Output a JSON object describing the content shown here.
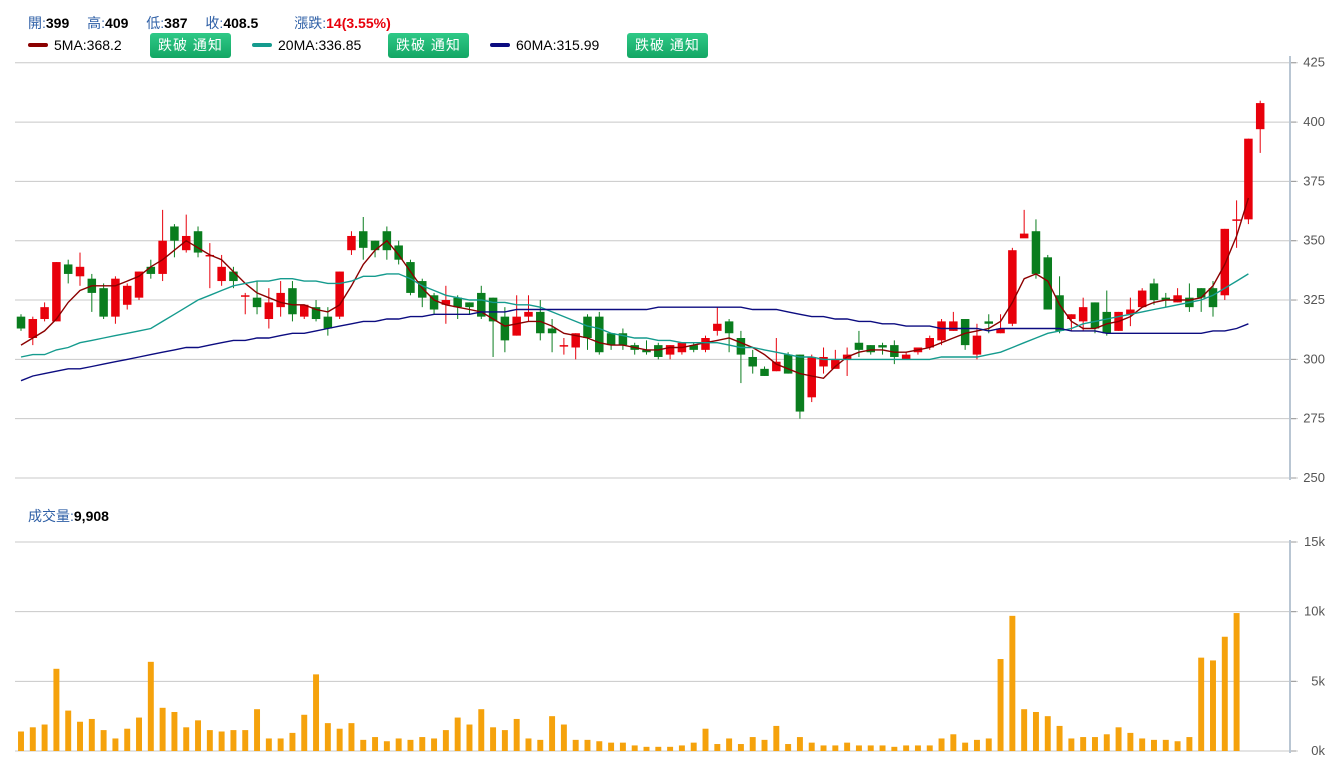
{
  "header": {
    "open_label": "開:",
    "open_value": "399",
    "high_label": "高:",
    "high_value": "409",
    "low_label": "低:",
    "low_value": "387",
    "close_label": "收:",
    "close_value": "408.5",
    "change_label": "漲跌:",
    "change_value": "14(3.55%)"
  },
  "legend": {
    "ma5": {
      "label": "5MA:368.2",
      "color": "#8b0000"
    },
    "ma20": {
      "label": "20MA:336.85",
      "color": "#159b8e"
    },
    "ma60": {
      "label": "60MA:315.99",
      "color": "#0c0c80"
    },
    "alert_button": "跌破 通知"
  },
  "volume_label": {
    "label": "成交量:",
    "value": "9,908"
  },
  "colors": {
    "up": "#e8000b",
    "down": "#0a7d1e",
    "volume": "#f5a20c",
    "grid": "#c8c8c8"
  },
  "chart_data": [
    {
      "type": "candlestick",
      "title": "",
      "y_ticks": [
        250,
        275,
        300,
        325,
        350,
        375,
        400,
        425
      ],
      "ylim": [
        250,
        427
      ],
      "series": [
        {
          "name": "OHLC",
          "points": [
            [
              318,
              313,
              319,
              312
            ],
            [
              309,
              317,
              318,
              306
            ],
            [
              317,
              322,
              324,
              316
            ],
            [
              316,
              341,
              341,
              316
            ],
            [
              340,
              336,
              342,
              332
            ],
            [
              335,
              339,
              345,
              331
            ],
            [
              334,
              328,
              336,
              320
            ],
            [
              330,
              318,
              332,
              317
            ],
            [
              318,
              334,
              335,
              315
            ],
            [
              323,
              331,
              332,
              321
            ],
            [
              326,
              337,
              337,
              325
            ],
            [
              339,
              336,
              342,
              334
            ],
            [
              336,
              350,
              363,
              333
            ],
            [
              356,
              350,
              357,
              343
            ],
            [
              346,
              352,
              361,
              345
            ],
            [
              354,
              345,
              356,
              343
            ],
            [
              344,
              344,
              349,
              330
            ],
            [
              333,
              339,
              344,
              331
            ],
            [
              337,
              333,
              339,
              330
            ],
            [
              327,
              327,
              328,
              319
            ],
            [
              326,
              322,
              333,
              319
            ],
            [
              317,
              324,
              330,
              313
            ],
            [
              322,
              328,
              333,
              318
            ],
            [
              330,
              319,
              333,
              316
            ],
            [
              318,
              323,
              323,
              317
            ],
            [
              322,
              317,
              325,
              316
            ],
            [
              318,
              313,
              322,
              310
            ],
            [
              318,
              337,
              337,
              317
            ],
            [
              346,
              352,
              354,
              344
            ],
            [
              354,
              347,
              360,
              342
            ],
            [
              350,
              346,
              350,
              343
            ],
            [
              354,
              346,
              356,
              342
            ],
            [
              348,
              342,
              350,
              340
            ],
            [
              341,
              328,
              342,
              327
            ],
            [
              333,
              326,
              334,
              322
            ],
            [
              327,
              321,
              328,
              319
            ],
            [
              323,
              325,
              331,
              315
            ],
            [
              326,
              322,
              327,
              317
            ],
            [
              324,
              322,
              324,
              319
            ],
            [
              328,
              318,
              331,
              317
            ],
            [
              326,
              316,
              326,
              301
            ],
            [
              318,
              308,
              322,
              303
            ],
            [
              310,
              318,
              327,
              310
            ],
            [
              318,
              320,
              327,
              316
            ],
            [
              320,
              311,
              325,
              308
            ],
            [
              313,
              311,
              317,
              303
            ],
            [
              306,
              306,
              309,
              302
            ],
            [
              305,
              311,
              311,
              300
            ],
            [
              318,
              309,
              319,
              304
            ],
            [
              318,
              303,
              320,
              302
            ],
            [
              311,
              306,
              311,
              304
            ],
            [
              311,
              306,
              313,
              304
            ],
            [
              306,
              304,
              307,
              302
            ],
            [
              304,
              303,
              308,
              302
            ],
            [
              306,
              301,
              307,
              300
            ],
            [
              302,
              306,
              306,
              300
            ],
            [
              303,
              307,
              307,
              302
            ],
            [
              306,
              304,
              307,
              303
            ],
            [
              304,
              309,
              310,
              303
            ],
            [
              312,
              315,
              322,
              310
            ],
            [
              316,
              311,
              317,
              303
            ],
            [
              309,
              302,
              312,
              290
            ],
            [
              301,
              297,
              304,
              294
            ],
            [
              296,
              293,
              297,
              293
            ],
            [
              295,
              299,
              309,
              295
            ],
            [
              302,
              294,
              303,
              294
            ],
            [
              302,
              278,
              302,
              275
            ],
            [
              284,
              301,
              302,
              282
            ],
            [
              297,
              301,
              305,
              294
            ],
            [
              296,
              300,
              304,
              297
            ],
            [
              300,
              302,
              305,
              293
            ],
            [
              307,
              304,
              312,
              301
            ],
            [
              306,
              303,
              306,
              302
            ],
            [
              306,
              305,
              307,
              302
            ],
            [
              306,
              301,
              308,
              298
            ],
            [
              300,
              302,
              303,
              300
            ],
            [
              303,
              305,
              305,
              302
            ],
            [
              305,
              309,
              310,
              304
            ],
            [
              308,
              316,
              317,
              306
            ],
            [
              312,
              316,
              320,
              312
            ],
            [
              317,
              306,
              317,
              304
            ],
            [
              302,
              310,
              315,
              300
            ],
            [
              316,
              315,
              319,
              311
            ],
            [
              311,
              313,
              319,
              311
            ],
            [
              315,
              346,
              347,
              314
            ],
            [
              351,
              353,
              363,
              352
            ],
            [
              354,
              336,
              359,
              334
            ],
            [
              343,
              321,
              344,
              321
            ],
            [
              327,
              312,
              335,
              311
            ],
            [
              317,
              319,
              319,
              312
            ],
            [
              316,
              322,
              326,
              312
            ],
            [
              324,
              313,
              324,
              311
            ],
            [
              320,
              311,
              329,
              310
            ],
            [
              312,
              320,
              320,
              312
            ],
            [
              319,
              321,
              326,
              314
            ],
            [
              322,
              329,
              330,
              322
            ],
            [
              332,
              325,
              334,
              323
            ],
            [
              326,
              325,
              328,
              322
            ],
            [
              324,
              327,
              330,
              324
            ],
            [
              326,
              322,
              332,
              320
            ],
            [
              330,
              326,
              330,
              320
            ],
            [
              330,
              322,
              333,
              318
            ],
            [
              327,
              355,
              355,
              325
            ],
            [
              359,
              359,
              367,
              347
            ],
            [
              359,
              393,
              393,
              357
            ],
            [
              397,
              408,
              409,
              387
            ]
          ]
        },
        {
          "name": "5MA",
          "values": [
            306,
            309,
            312,
            317,
            324,
            329,
            331,
            331,
            331,
            333,
            335,
            339,
            342,
            346,
            350,
            347,
            344,
            342,
            337,
            332,
            328,
            326,
            324,
            323,
            323,
            321,
            320,
            323,
            331,
            340,
            346,
            350,
            344,
            337,
            330,
            325,
            323,
            322,
            321,
            320,
            317,
            314,
            315,
            316,
            316,
            314,
            311,
            310,
            309,
            307,
            306,
            306,
            305,
            304,
            304,
            305,
            305,
            306,
            307,
            308,
            309,
            307,
            305,
            302,
            298,
            296,
            294,
            293,
            292,
            297,
            301,
            303,
            304,
            304,
            303,
            303,
            304,
            305,
            307,
            309,
            311,
            312,
            313,
            316,
            324,
            334,
            336,
            333,
            323,
            316,
            313,
            313,
            315,
            316,
            318,
            322,
            324,
            325,
            325,
            325,
            326,
            331,
            340,
            352,
            368
          ]
        },
        {
          "name": "20MA",
          "values": [
            301,
            302,
            302,
            304,
            305,
            307,
            308,
            309,
            310,
            311,
            312,
            313,
            316,
            319,
            322,
            325,
            327,
            329,
            331,
            332,
            333,
            333,
            334,
            334,
            333,
            333,
            332,
            332,
            333,
            335,
            335,
            336,
            336,
            334,
            331,
            329,
            327,
            326,
            325,
            325,
            324,
            324,
            323,
            323,
            322,
            320,
            318,
            316,
            314,
            313,
            311,
            310,
            309,
            309,
            308,
            308,
            307,
            307,
            307,
            307,
            306,
            305,
            305,
            304,
            303,
            302,
            301,
            301,
            300,
            300,
            300,
            300,
            300,
            300,
            300,
            300,
            300,
            300,
            301,
            301,
            301,
            301,
            302,
            303,
            305,
            307,
            309,
            311,
            312,
            313,
            315,
            316,
            317,
            318,
            319,
            320,
            321,
            322,
            323,
            324,
            325,
            327,
            330,
            333,
            336
          ]
        },
        {
          "name": "60MA",
          "values": [
            291,
            293,
            294,
            295,
            296,
            296,
            297,
            298,
            299,
            300,
            301,
            302,
            303,
            304,
            305,
            305,
            306,
            307,
            308,
            308,
            309,
            309,
            310,
            311,
            311,
            312,
            313,
            314,
            315,
            316,
            316,
            317,
            317,
            318,
            318,
            319,
            319,
            319,
            319,
            320,
            320,
            320,
            321,
            321,
            321,
            321,
            321,
            321,
            321,
            321,
            321,
            321,
            321,
            321,
            322,
            322,
            322,
            322,
            322,
            322,
            322,
            322,
            321,
            321,
            321,
            320,
            319,
            318,
            318,
            317,
            317,
            316,
            316,
            315,
            315,
            314,
            314,
            314,
            313,
            313,
            313,
            313,
            312,
            313,
            313,
            313,
            313,
            313,
            313,
            312,
            312,
            312,
            311,
            311,
            311,
            311,
            311,
            311,
            311,
            311,
            311,
            312,
            312,
            313,
            315
          ]
        }
      ]
    },
    {
      "type": "bar",
      "title": "",
      "y_ticks": [
        0,
        5000,
        10000,
        15000
      ],
      "y_tick_labels": [
        "0k",
        "5k",
        "10k",
        "15k"
      ],
      "ylim": [
        0,
        15000
      ],
      "values": [
        1400,
        1700,
        1900,
        5900,
        2900,
        2100,
        2300,
        1500,
        900,
        1600,
        2400,
        6400,
        3100,
        2800,
        1700,
        2200,
        1500,
        1400,
        1500,
        1500,
        3000,
        900,
        900,
        1300,
        2600,
        5500,
        2000,
        1600,
        2000,
        800,
        1000,
        700,
        900,
        800,
        1000,
        900,
        1500,
        2400,
        1900,
        3000,
        1700,
        1500,
        2300,
        900,
        800,
        2500,
        1900,
        800,
        800,
        700,
        600,
        600,
        400,
        300,
        300,
        300,
        400,
        600,
        1600,
        500,
        900,
        500,
        1000,
        800,
        1800,
        500,
        1000,
        600,
        400,
        400,
        600,
        400,
        400,
        400,
        300,
        400,
        400,
        400,
        900,
        1200,
        600,
        800,
        900,
        6600,
        9700,
        3000,
        2800,
        2500,
        1800,
        900,
        1000,
        1000,
        1200,
        1700,
        1300,
        900,
        800,
        800,
        700,
        1000,
        6700,
        6500,
        8200,
        9900
      ]
    }
  ]
}
